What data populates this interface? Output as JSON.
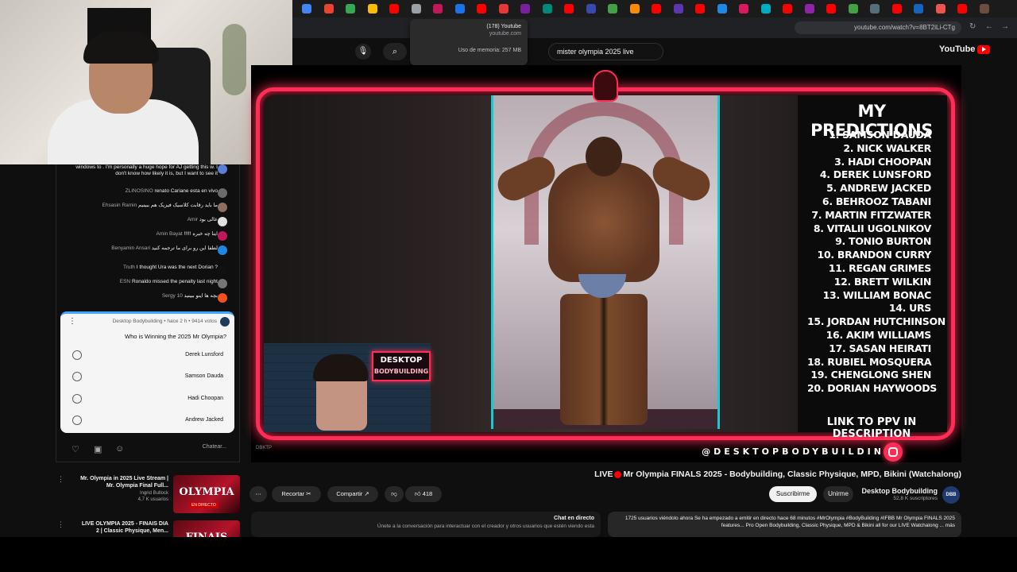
{
  "browser": {
    "tab_tooltip": {
      "title": "(178) Youtube",
      "domain": "youtube.com",
      "memory": "Uso de memoria: 257 MB"
    },
    "address_url": "youtube.com/watch?v=8BT2iLi-CTg",
    "tab_colors": [
      "#4285f4",
      "#ea4335",
      "#34a853",
      "#fbbc05",
      "#ff0000",
      "#9aa0a6",
      "#c2185b",
      "#1a73e8",
      "#ff0000",
      "#e53935",
      "#7b1fa2",
      "#00897b",
      "#ff0000",
      "#3949ab",
      "#43a047",
      "#fb8c00",
      "#ff0000",
      "#5e35b1",
      "#ff0000",
      "#1e88e5",
      "#d81b60",
      "#00acc1",
      "#ff0000",
      "#8e24aa",
      "#ff0000",
      "#43a047",
      "#546e7a",
      "#ff0000",
      "#1565c0",
      "#ef5350",
      "#ff0000",
      "#6d4c41"
    ]
  },
  "youtube": {
    "search_query": "mister olympia 2025 live",
    "logo_text": "YouTube",
    "accent": "#ff0000"
  },
  "chat": {
    "messages": [
      {
        "name": "",
        "text": "windows to . I'm personally a huge hope for AJ getting this w. I don't know how likely it is, but I want to see it",
        "color": "#5b7fd6"
      },
      {
        "name": "ZLINOSINO",
        "text": "renato Cariane esta en vivo",
        "color": "#6b6b6b"
      },
      {
        "name": "Ehsasin Ramin",
        "text": "ما باید رقابت کلاسیک فیزیک هم ببینیم",
        "color": "#8d6e63"
      },
      {
        "name": "Amir",
        "text": "عالی بود",
        "color": "#e0e0e0"
      },
      {
        "name": "Amin Bayat",
        "text": "!!!!! اینا چه خبره",
        "color": "#c2185b"
      },
      {
        "name": "Benyamin Ansari",
        "text": "لطفا این رو برای ما ترجمه کنید",
        "color": "#1e88e5"
      },
      {
        "name": "Truth",
        "text": "I thought Ura was the next Dorian ?",
        "color": "#111111"
      },
      {
        "name": "ESN",
        "text": "Ronaldo missed the penalty last night",
        "color": "#757575"
      },
      {
        "name": "Sergy 10",
        "text": "بچه ها اینو ببینید",
        "color": "#f4511e"
      }
    ],
    "poll": {
      "header": "Desktop Bodybuilding • hace 2 h • 9414 votos",
      "question": "Who is Winning the 2025 Mr Olympia?",
      "options": [
        "Derek Lunsford",
        "Samson Dauda",
        "Hadi Choopan",
        "Andrew Jacked"
      ]
    },
    "input_placeholder": "Chatear...",
    "icons": [
      "heart-icon",
      "gift-icon",
      "emoji-icon"
    ]
  },
  "video": {
    "predictions_title": "MY PREDICTIONS",
    "predictions": [
      "1. SAMSON DAUDA",
      "2. NICK WALKER",
      "3. HADI CHOOPAN",
      "4. DEREK LUNSFORD",
      "5. ANDREW JACKED",
      "6. BEHROOZ TABANI",
      "7. MARTIN FITZWATER",
      "8. VITALII UGOLNIKOV",
      "9. TONIO BURTON",
      "10. BRANDON CURRY",
      "11. REGAN GRIMES",
      "12. BRETT WILKIN",
      "13. WILLIAM BONAC",
      "14. URS",
      "15. JORDAN HUTCHINSON",
      "16. AKIM WILLIAMS",
      "17. SASAN HEIRATI",
      "18. RUBIEL MOSQUERA",
      "19. CHENGLONG SHEN",
      "20. DORIAN HAYWOODS"
    ],
    "predictions_footer": "LINK TO PPV IN DESCRIPTION",
    "handle": "@DESKTOPBODYBUILDING",
    "badge_line1": "DESKTOP",
    "badge_line2": "BODYBUILDING",
    "watermark": "DBKTP",
    "neon_color": "#ff2d55",
    "stage_accent": "#1bc7d4"
  },
  "meta": {
    "title_prefix": "LIVE",
    "title": "Mr Olympia FINALS 2025 - Bodybuilding, Classic Physique, MPD, Bikini (Watchalong)",
    "channel": "Desktop Bodybuilding",
    "channel_avatar": "DBB",
    "subscribers": "52,8 K suscriptores",
    "subscribe_label": "Suscribirme",
    "join_label": "Unirme",
    "likes": "418",
    "share_label": "Compartir",
    "clip_label": "Recortar",
    "more_label": "⋯",
    "description": "1725 usuarios viéndolo ahora  Se ha empezado a emitir en directo hace 68 minutos  #MrOlympia #BodyBuilding #IFBB Mr Olympia FINALS 2025 features... Pro Open Bodybuilding, Classic Physique, MPD & Bikini all for our LIVE Watchalong ... más",
    "chat_replay_title": "Chat en directo",
    "chat_replay_desc": "Únete a la conversación para interactuar con el creador y otros usuarios que estén viendo esta"
  },
  "related": [
    {
      "title": "Mr. Olympia in 2025 Live Stream | Mr. Olympia Final Full...",
      "channel": "Ingrid Bullock",
      "views": "4,7 K usuarios",
      "thumb_text": "OLYMPIA",
      "chip": "EN DIRECTO"
    },
    {
      "title": "LIVE OLYMPIA 2025 - FINAIS DIA 2 | Classic Physique, Men...",
      "channel": "",
      "views": "",
      "thumb_text": "FINAIS",
      "chip": ""
    }
  ]
}
